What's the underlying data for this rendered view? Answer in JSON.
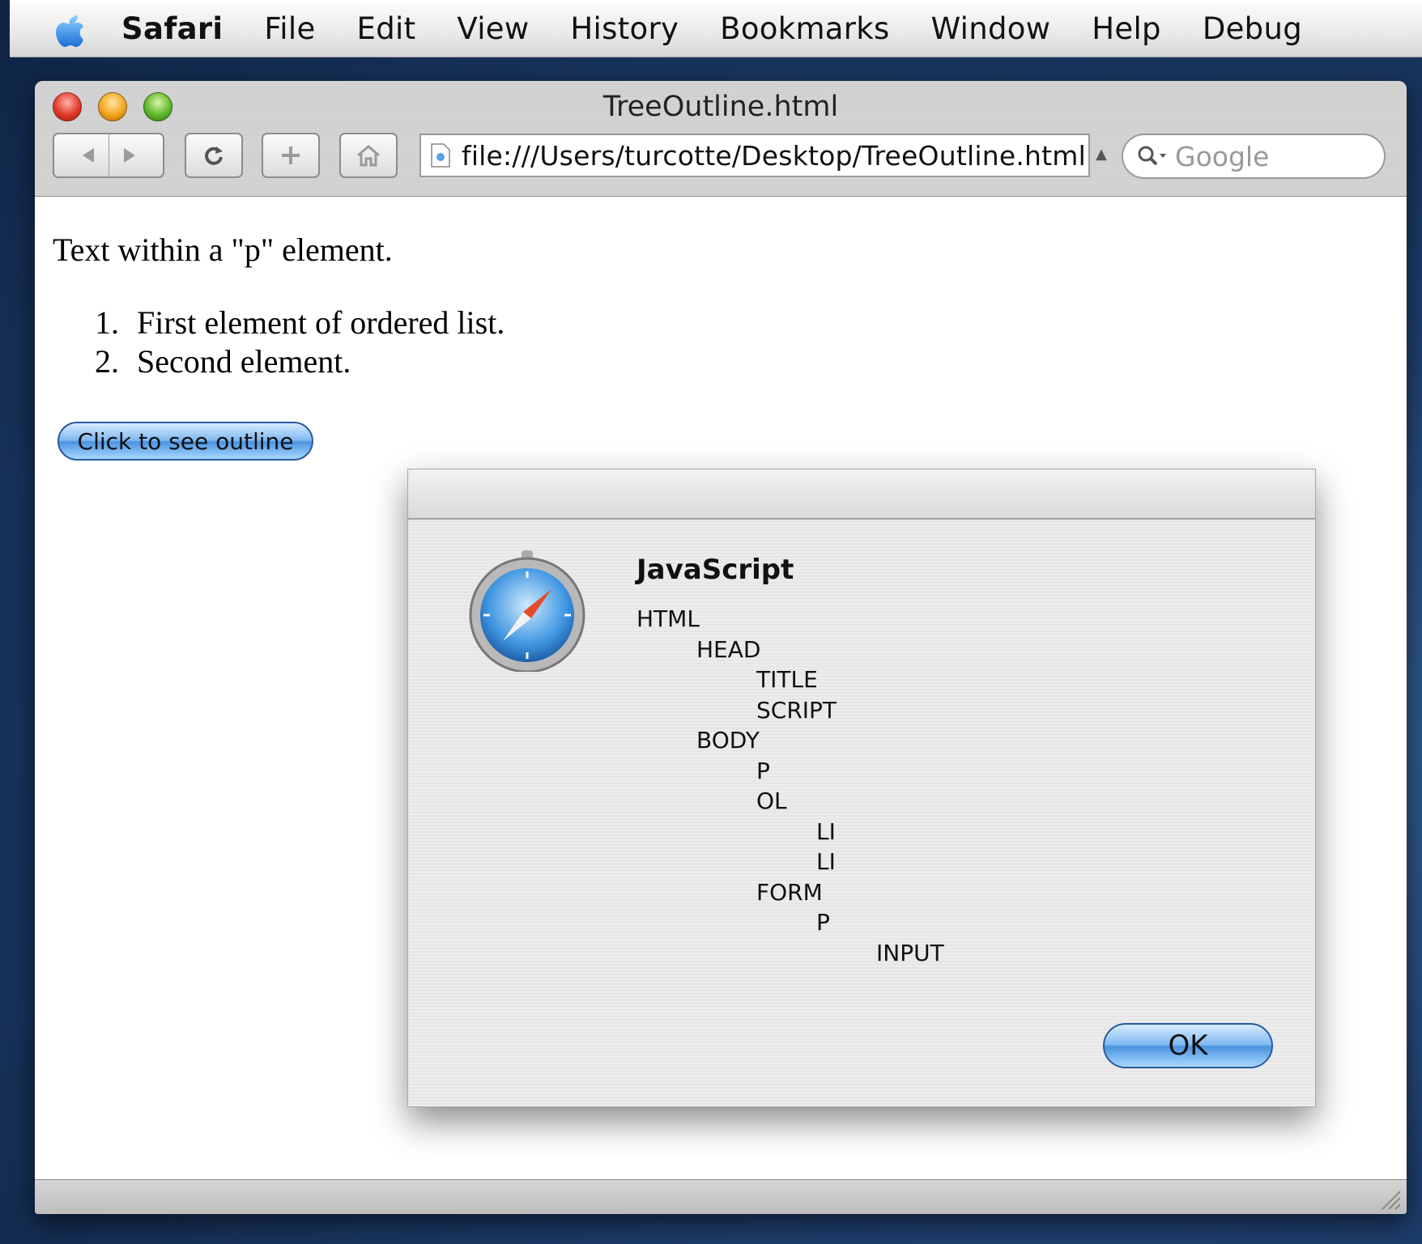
{
  "menubar": {
    "app": "Safari",
    "items": [
      "File",
      "Edit",
      "View",
      "History",
      "Bookmarks",
      "Window",
      "Help",
      "Debug"
    ]
  },
  "window": {
    "title": "TreeOutline.html",
    "address": "file:///Users/turcotte/Desktop/TreeOutline.html",
    "search_placeholder": "Google"
  },
  "page": {
    "paragraph": "Text within a \"p\" element.",
    "list": [
      {
        "num": "1.",
        "text": "First element of ordered list."
      },
      {
        "num": "2.",
        "text": "Second element."
      }
    ],
    "button_label": "Click to see outline"
  },
  "dialog": {
    "title": "JavaScript",
    "tree": [
      {
        "label": "HTML",
        "depth": 0
      },
      {
        "label": "HEAD",
        "depth": 1
      },
      {
        "label": "TITLE",
        "depth": 2
      },
      {
        "label": "SCRIPT",
        "depth": 2
      },
      {
        "label": "BODY",
        "depth": 1
      },
      {
        "label": "P",
        "depth": 2
      },
      {
        "label": "OL",
        "depth": 2
      },
      {
        "label": "LI",
        "depth": 3
      },
      {
        "label": "LI",
        "depth": 3
      },
      {
        "label": "FORM",
        "depth": 2
      },
      {
        "label": "P",
        "depth": 3
      },
      {
        "label": "INPUT",
        "depth": 4
      }
    ],
    "ok_label": "OK"
  }
}
